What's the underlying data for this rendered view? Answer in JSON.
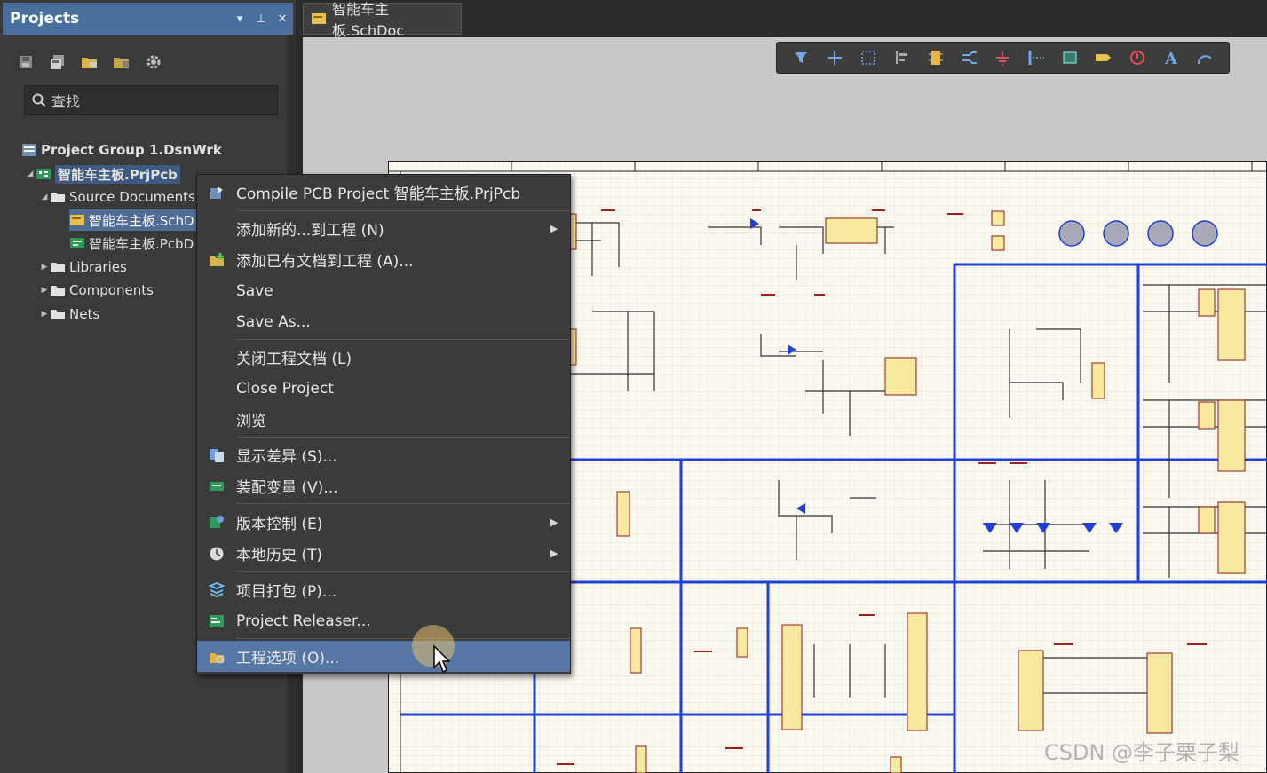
{
  "panel": {
    "title": "Projects",
    "header_buttons": [
      "▾",
      "⊥",
      "✕"
    ],
    "search_placeholder": "查找",
    "tree": {
      "group": "Project Group 1.DsnWrk",
      "project": "智能车主板.PrjPcb",
      "source_documents": "Source Documents",
      "schdoc": "智能车主板.SchD",
      "pcbdoc": "智能车主板.PcbD",
      "libraries": "Libraries",
      "components": "Components",
      "nets": "Nets"
    }
  },
  "tab": {
    "label": "智能车主板.SchDoc"
  },
  "context_menu": {
    "items": [
      {
        "label": "Compile PCB Project 智能车主板.PrjPcb",
        "icon": "compile-icon"
      },
      {
        "label": "添加新的...到工程 (N)",
        "submenu": true
      },
      {
        "label": "添加已有文档到工程 (A)...",
        "icon": "add-existing-icon"
      },
      {
        "label": "Save"
      },
      {
        "label": "Save As..."
      },
      {
        "label": "关闭工程文档 (L)"
      },
      {
        "label": "Close Project"
      },
      {
        "label": "浏览"
      },
      {
        "label": "显示差异 (S)...",
        "icon": "diff-icon"
      },
      {
        "label": "装配变量 (V)...",
        "icon": "variant-icon"
      },
      {
        "label": "版本控制 (E)",
        "icon": "version-control-icon",
        "submenu": true
      },
      {
        "label": "本地历史 (T)",
        "icon": "history-icon",
        "submenu": true
      },
      {
        "label": "项目打包 (P)...",
        "icon": "package-icon"
      },
      {
        "label": "Project Releaser...",
        "icon": "releaser-icon"
      },
      {
        "label": "工程选项 (O)...",
        "icon": "options-icon"
      }
    ]
  },
  "watermark": "CSDN @李子栗子梨",
  "colors": {
    "accent": "#4a6f9e",
    "highlight": "#5677a6",
    "wire": "#1f3fd6",
    "component": "#f8e9a0"
  }
}
